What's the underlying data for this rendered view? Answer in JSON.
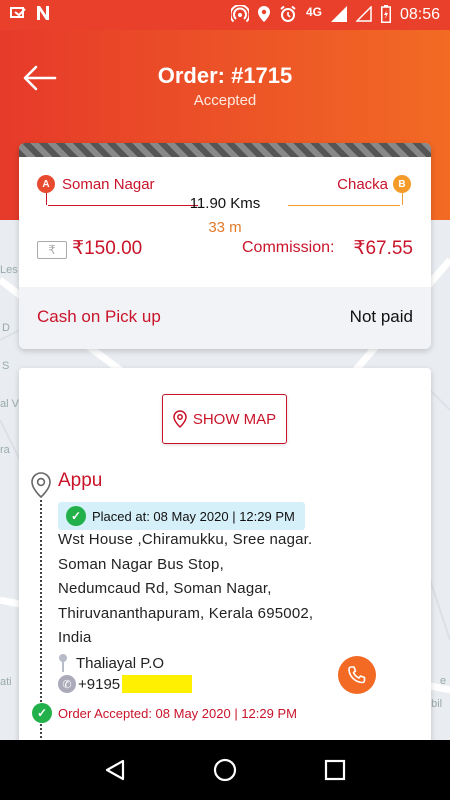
{
  "status_bar": {
    "left_icons": [
      "app-icon",
      "netflix-icon"
    ],
    "network": "4G",
    "time": "08:56"
  },
  "header": {
    "title": "Order: #1715",
    "subtitle": "Accepted",
    "gradient_start": "#e63a2a",
    "gradient_end": "#f26a24"
  },
  "route": {
    "pickup_pin": "A",
    "pickup": "Soman Nagar",
    "drop_pin": "B",
    "drop": "Chacka",
    "distance": "11.90 Kms",
    "duration": "33 m"
  },
  "payment": {
    "currency_icon": "₹",
    "amount": "₹150.00",
    "commission_label": "Commission:",
    "commission": "₹67.55",
    "method": "Cash on Pick up",
    "status": "Not paid"
  },
  "details": {
    "show_map_label": "SHOW MAP",
    "customer_name": "Appu",
    "placed_at": "Placed at: 08 May 2020 | 12:29 PM",
    "address_lines": [
      "Wst House ,Chiramukku, Sree nagar.",
      "Soman Nagar Bus Stop,",
      "Nedumcaud Rd, Soman Nagar,",
      "Thiruvananthapuram, Kerala 695002,",
      "India"
    ],
    "post_office": "Thaliayal P.O",
    "phone": "+9195",
    "order_accepted": "Order Accepted: 08 May 2020 | 12:29 PM"
  },
  "map_labels": [
    "Les",
    "D",
    "S",
    "al V",
    "ra",
    "ati",
    "obil",
    "e"
  ],
  "colors": {
    "accent": "#c9142a",
    "orange": "#f26a24",
    "success": "#22b04a",
    "placed_bg": "#d6f0fa"
  }
}
